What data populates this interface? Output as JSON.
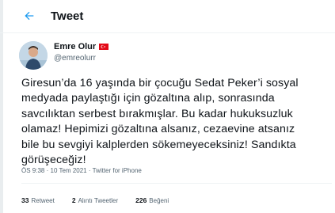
{
  "header": {
    "title": "Tweet"
  },
  "author": {
    "name": "Emre Olur",
    "handle": "@emreolurr"
  },
  "tweet": {
    "text": "Giresun’da 16 yaşında bir çocuğu Sedat Peker’i sosyal\nmedyada paylaştığı için gözaltına alıp, sonrasında\nsavcılıktan serbest bırakmışlar. Bu kadar hukuksuzluk\nolamaz! Hepimizi gözaltına alsanız, cezaevine atsanız\nbile bu sevgiyi kalplerden sökemeyeceksiniz! Sandıkta\ngörüşeceğiz!"
  },
  "meta": {
    "time": "ÖS 9:38",
    "sep1": "·",
    "date": "10 Tem 2021",
    "sep2": "·",
    "source": "Twitter for iPhone"
  },
  "stats": {
    "retweets": {
      "count": "33",
      "label": "Retweet"
    },
    "quotes": {
      "count": "2",
      "label": "Alıntı Tweetler"
    },
    "likes": {
      "count": "226",
      "label": "Beğeni"
    }
  },
  "icons": {
    "back": "arrow-left-icon",
    "flag": "turkey-flag-icon"
  },
  "colors": {
    "accent": "#1d9bf0",
    "secondary_text": "#536471",
    "flag_red": "#e30a17"
  }
}
